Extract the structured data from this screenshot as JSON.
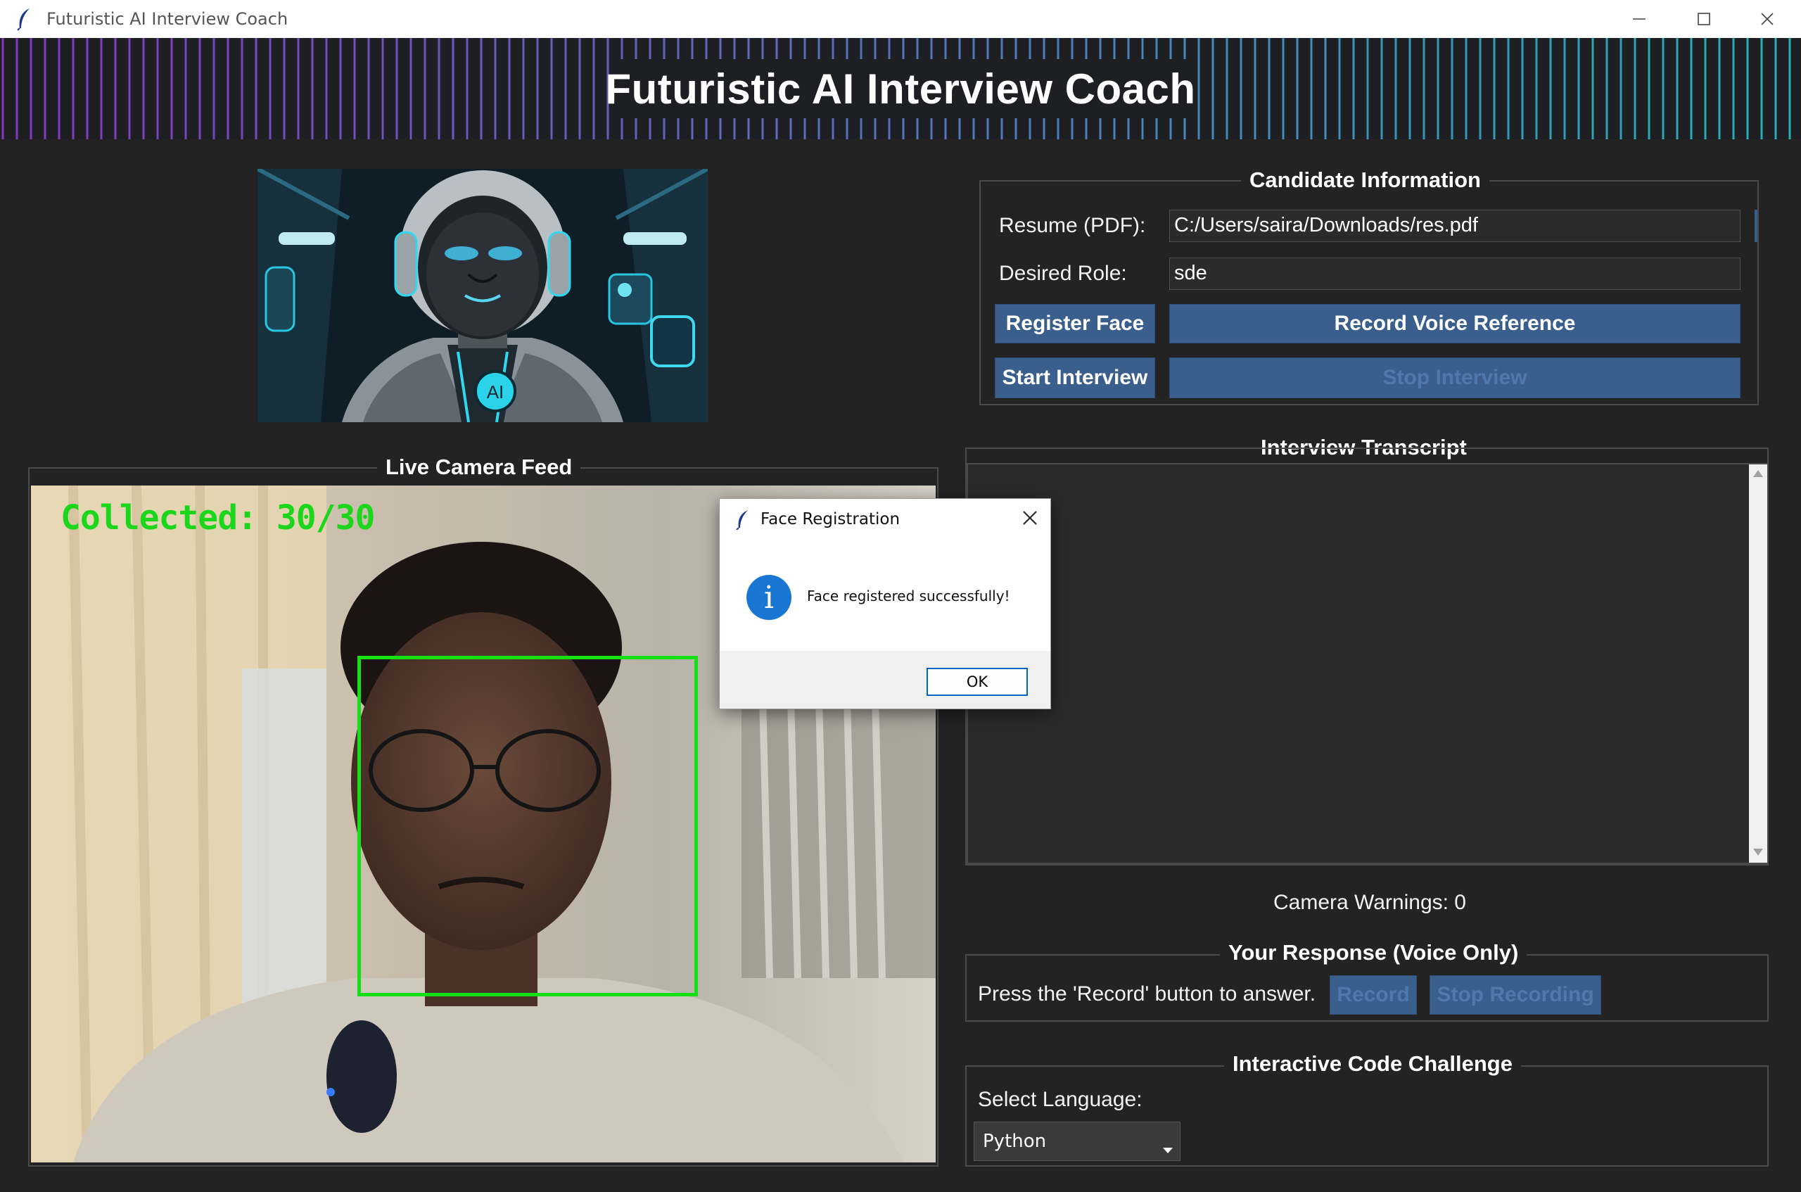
{
  "window": {
    "title": "Futuristic AI Interview Coach"
  },
  "header": {
    "title": "Futuristic AI Interview Coach"
  },
  "robot": {
    "badge": "AI"
  },
  "candidate": {
    "section_title": "Candidate Information",
    "resume_label": "Resume (PDF):",
    "resume_value": "C:/Users/saira/Downloads/res.pdf",
    "role_label": "Desired Role:",
    "role_value": "sde",
    "register_face": "Register Face",
    "record_voice": "Record Voice Reference",
    "start_interview": "Start Interview",
    "stop_interview": "Stop Interview"
  },
  "camera": {
    "section_title": "Live Camera Feed",
    "overlay_text": "Collected: 30/30"
  },
  "transcript": {
    "section_title": "Interview Transcript"
  },
  "warnings": {
    "text": "Camera Warnings: 0"
  },
  "response": {
    "section_title": "Your Response (Voice Only)",
    "prompt": "Press the 'Record' button to answer.",
    "record": "Record",
    "stop_recording": "Stop Recording"
  },
  "code": {
    "section_title": "Interactive Code Challenge",
    "language_label": "Select Language:",
    "language_value": "Python"
  },
  "dialog": {
    "title": "Face Registration",
    "message": "Face registered successfully!",
    "ok": "OK",
    "icon": "info-icon"
  },
  "colors": {
    "background": "#232323",
    "button": "#3a5f8c",
    "face_box": "#14e014",
    "overlay_text": "#1bd61b"
  }
}
